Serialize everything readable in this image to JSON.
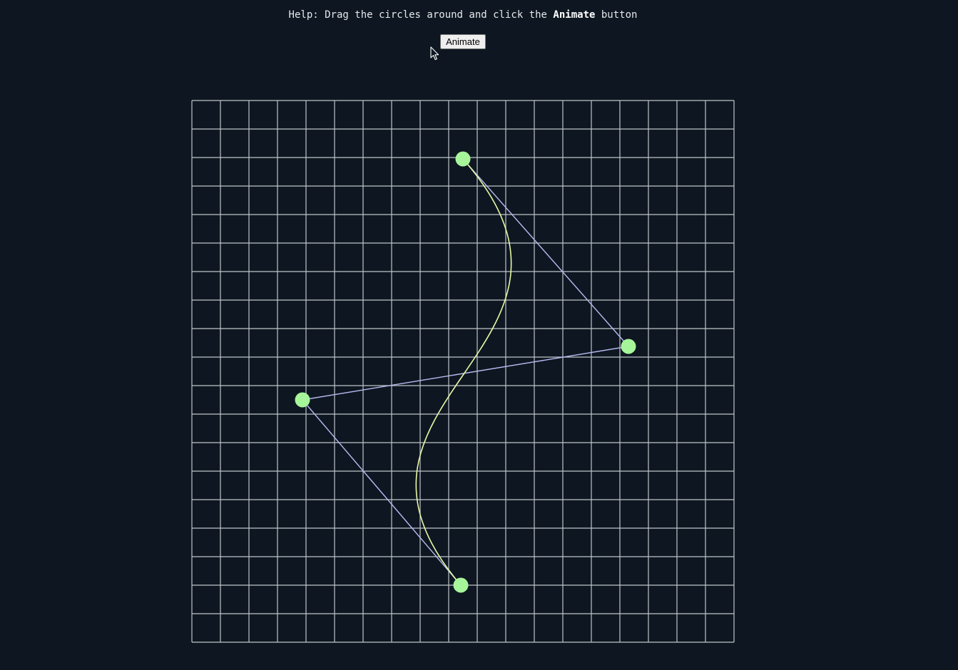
{
  "help": {
    "prefix": "Help: Drag the circles around and click the ",
    "emphasis": "Animate",
    "suffix": " button"
  },
  "toolbar": {
    "animate_label": "Animate"
  },
  "curve": {
    "control_points": [
      {
        "name": "point-1",
        "x": 9.5,
        "y": 2.05
      },
      {
        "name": "point-2",
        "x": 15.3,
        "y": 8.625
      },
      {
        "name": "point-3",
        "x": 3.875,
        "y": 10.5
      },
      {
        "name": "point-4",
        "x": 9.425,
        "y": 17.0
      }
    ]
  },
  "grid": {
    "columns": 19,
    "rows": 19
  },
  "colors": {
    "background": "#0e1721",
    "grid_line": "#c0c4ca",
    "control_polygon": "#b8bcf2",
    "bezier_curve": "#e6f7a6",
    "control_point": "#a6f59a"
  },
  "icons": {
    "cursor": "arrow-cursor-icon"
  }
}
